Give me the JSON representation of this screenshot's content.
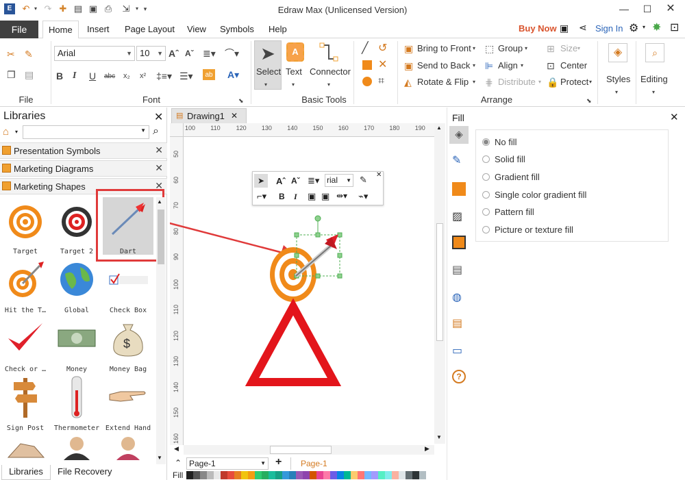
{
  "app": {
    "title": "Edraw Max (Unlicensed Version)"
  },
  "menu": {
    "file": "File",
    "tabs": [
      "Home",
      "Insert",
      "Page Layout",
      "View",
      "Symbols",
      "Help"
    ],
    "active": "Home"
  },
  "account": {
    "buy_now": "Buy Now",
    "sign_in": "Sign In"
  },
  "ribbon": {
    "file_group": "File",
    "font_group": "Font",
    "font_name": "Arial",
    "font_size": "10",
    "basic_tools_group": "Basic Tools",
    "select_label": "Select",
    "text_label": "Text",
    "connector_label": "Connector",
    "arrange_group": "Arrange",
    "bring_front": "Bring to Front",
    "send_back": "Send to Back",
    "rotate_flip": "Rotate & Flip",
    "group": "Group",
    "align": "Align",
    "distribute": "Distribute",
    "size": "Size",
    "center": "Center",
    "protect": "Protect",
    "styles": "Styles",
    "editing": "Editing"
  },
  "libraries": {
    "title": "Libraries",
    "rows": [
      "Presentation Symbols",
      "Marketing Diagrams",
      "Marketing Shapes"
    ],
    "shapes": [
      "Target",
      "Target 2",
      "Dart",
      "Hit the T…",
      "Global",
      "Check Box",
      "Check or …",
      "Money",
      "Money Bag",
      "Sign Post",
      "Thermometer",
      "Extend Hand"
    ],
    "tabs": [
      "Libraries",
      "File Recovery"
    ]
  },
  "document": {
    "tab": "Drawing1",
    "ruler_h": [
      "100",
      "110",
      "120",
      "130",
      "140",
      "150",
      "160",
      "170",
      "180",
      "190"
    ],
    "ruler_v": [
      "50",
      "60",
      "70",
      "80",
      "90",
      "100",
      "110",
      "120",
      "130",
      "140",
      "150",
      "160"
    ],
    "mini_font": "rial",
    "page_select": "Page-1",
    "page_tab": "Page-1",
    "fill_label": "Fill"
  },
  "fill_panel": {
    "title": "Fill",
    "options": [
      "No fill",
      "Solid fill",
      "Gradient fill",
      "Single color gradient fill",
      "Pattern fill",
      "Picture or texture fill"
    ],
    "selected": 0
  },
  "colors": {
    "accent": "#d9532c",
    "file_tab": "#404040",
    "highlight_box": "#e03a3a"
  }
}
